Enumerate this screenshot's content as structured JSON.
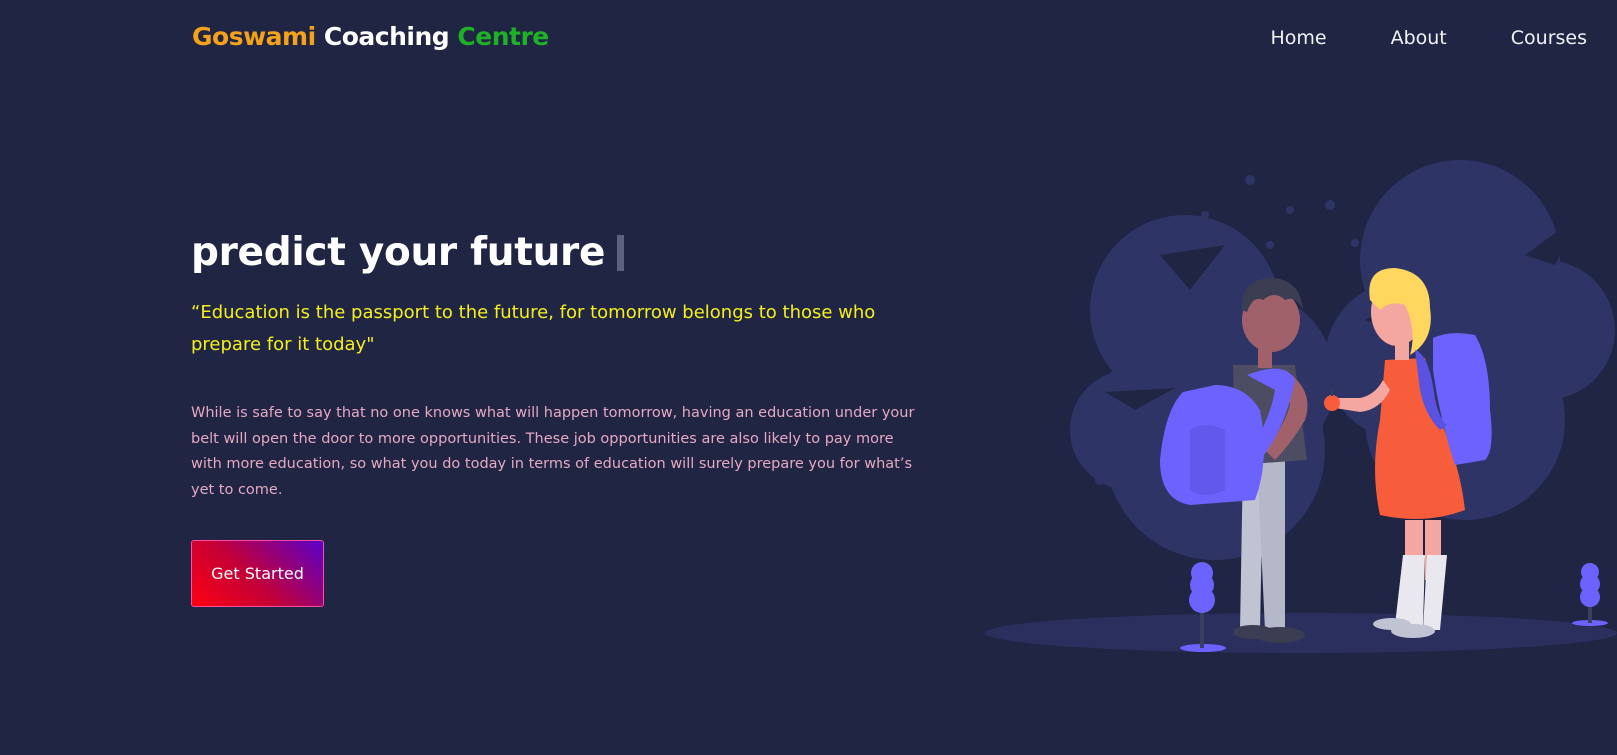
{
  "brand": {
    "word1": "Goswami",
    "word2": "Coaching",
    "word3": "Centre",
    "colors": {
      "word1": "#f5a21a",
      "word2": "#ffffff",
      "word3": "#1fb125"
    }
  },
  "nav": {
    "items": [
      {
        "label": "Home"
      },
      {
        "label": "About"
      },
      {
        "label": "Courses"
      }
    ]
  },
  "hero": {
    "title": "predict your future",
    "quote": "“Education is the passport to the future, for tomorrow belongs to those who prepare for it today\"",
    "description": "While is safe to say that no one knows what will happen tomorrow, having an education under your belt will open the door to more opportunities. These job opportunities are also likely to pay more with more education, so what you do today in terms of education will surely prepare you for what’s yet to come.",
    "cta_label": "Get Started"
  },
  "theme": {
    "background": "#1f2543",
    "quote_color": "#f5f01c",
    "description_color": "#e6a9c4",
    "cta_gradient": [
      "#ff0011",
      "#5a00c8"
    ]
  },
  "illustration": {
    "icon": "students-with-backpacks-illustration"
  }
}
